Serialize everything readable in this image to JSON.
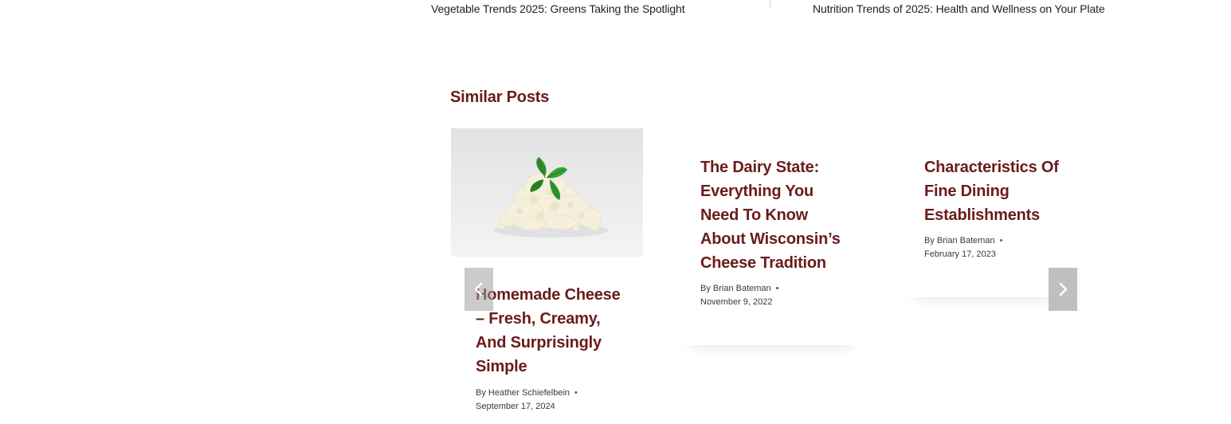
{
  "post_navigation": {
    "previous_title": "Vegetable Trends 2025: Greens Taking the Spotlight",
    "next_title": "Nutrition Trends of 2025: Health and Wellness on Your Plate"
  },
  "similar_posts": {
    "heading": "Similar Posts",
    "cards": [
      {
        "title": "Homemade Cheese – Fresh, Creamy, And Surprisingly Simple",
        "author": "By Heather Schiefelbein",
        "date": "September 17, 2024",
        "image": "cottage-cheese-with-basil-photo"
      },
      {
        "title": "The Dairy State: Everything You Need To Know About Wisconsin’s Cheese Tradition",
        "author": "By Brian Bateman",
        "date": "November 9, 2022"
      },
      {
        "title": "Characteristics Of Fine Dining Establishments",
        "author": "By Brian Bateman",
        "date": "February 17, 2023"
      }
    ],
    "prev_icon": "chevron-left-icon",
    "next_icon": "chevron-right-icon"
  },
  "colors": {
    "heading": "#6b1b1b",
    "text": "#1f1f1f",
    "meta": "#3a3a3a"
  }
}
